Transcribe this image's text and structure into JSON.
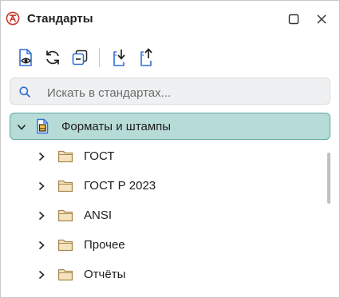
{
  "window": {
    "title": "Стандарты",
    "icon": "app-logo-icon",
    "maximize_icon": "maximize-icon",
    "close_icon": "close-icon"
  },
  "toolbar": {
    "buttons": [
      {
        "icon": "preview-document-icon"
      },
      {
        "icon": "refresh-icon"
      },
      {
        "icon": "collapse-all-icon"
      },
      {
        "icon": "import-icon"
      },
      {
        "icon": "export-icon"
      }
    ]
  },
  "search": {
    "placeholder": "Искать в стандартах...",
    "value": ""
  },
  "tree": {
    "root": {
      "label": "Форматы и штампы",
      "expanded": true,
      "selected": true,
      "icon": "document-template-icon"
    },
    "items": [
      {
        "label": "ГОСТ",
        "icon": "folder-icon"
      },
      {
        "label": "ГОСТ Р 2023",
        "icon": "folder-icon"
      },
      {
        "label": "ANSI",
        "icon": "folder-icon"
      },
      {
        "label": "Прочее",
        "icon": "folder-icon"
      },
      {
        "label": "Отчёты",
        "icon": "folder-icon"
      }
    ]
  },
  "colors": {
    "accent": "#2f6fd6",
    "selection_bg": "#b7dcd8",
    "selection_border": "#5ea7a1",
    "folder_fill": "#f3e3bf",
    "folder_stroke": "#a9884f",
    "logo_red": "#c8392e"
  }
}
